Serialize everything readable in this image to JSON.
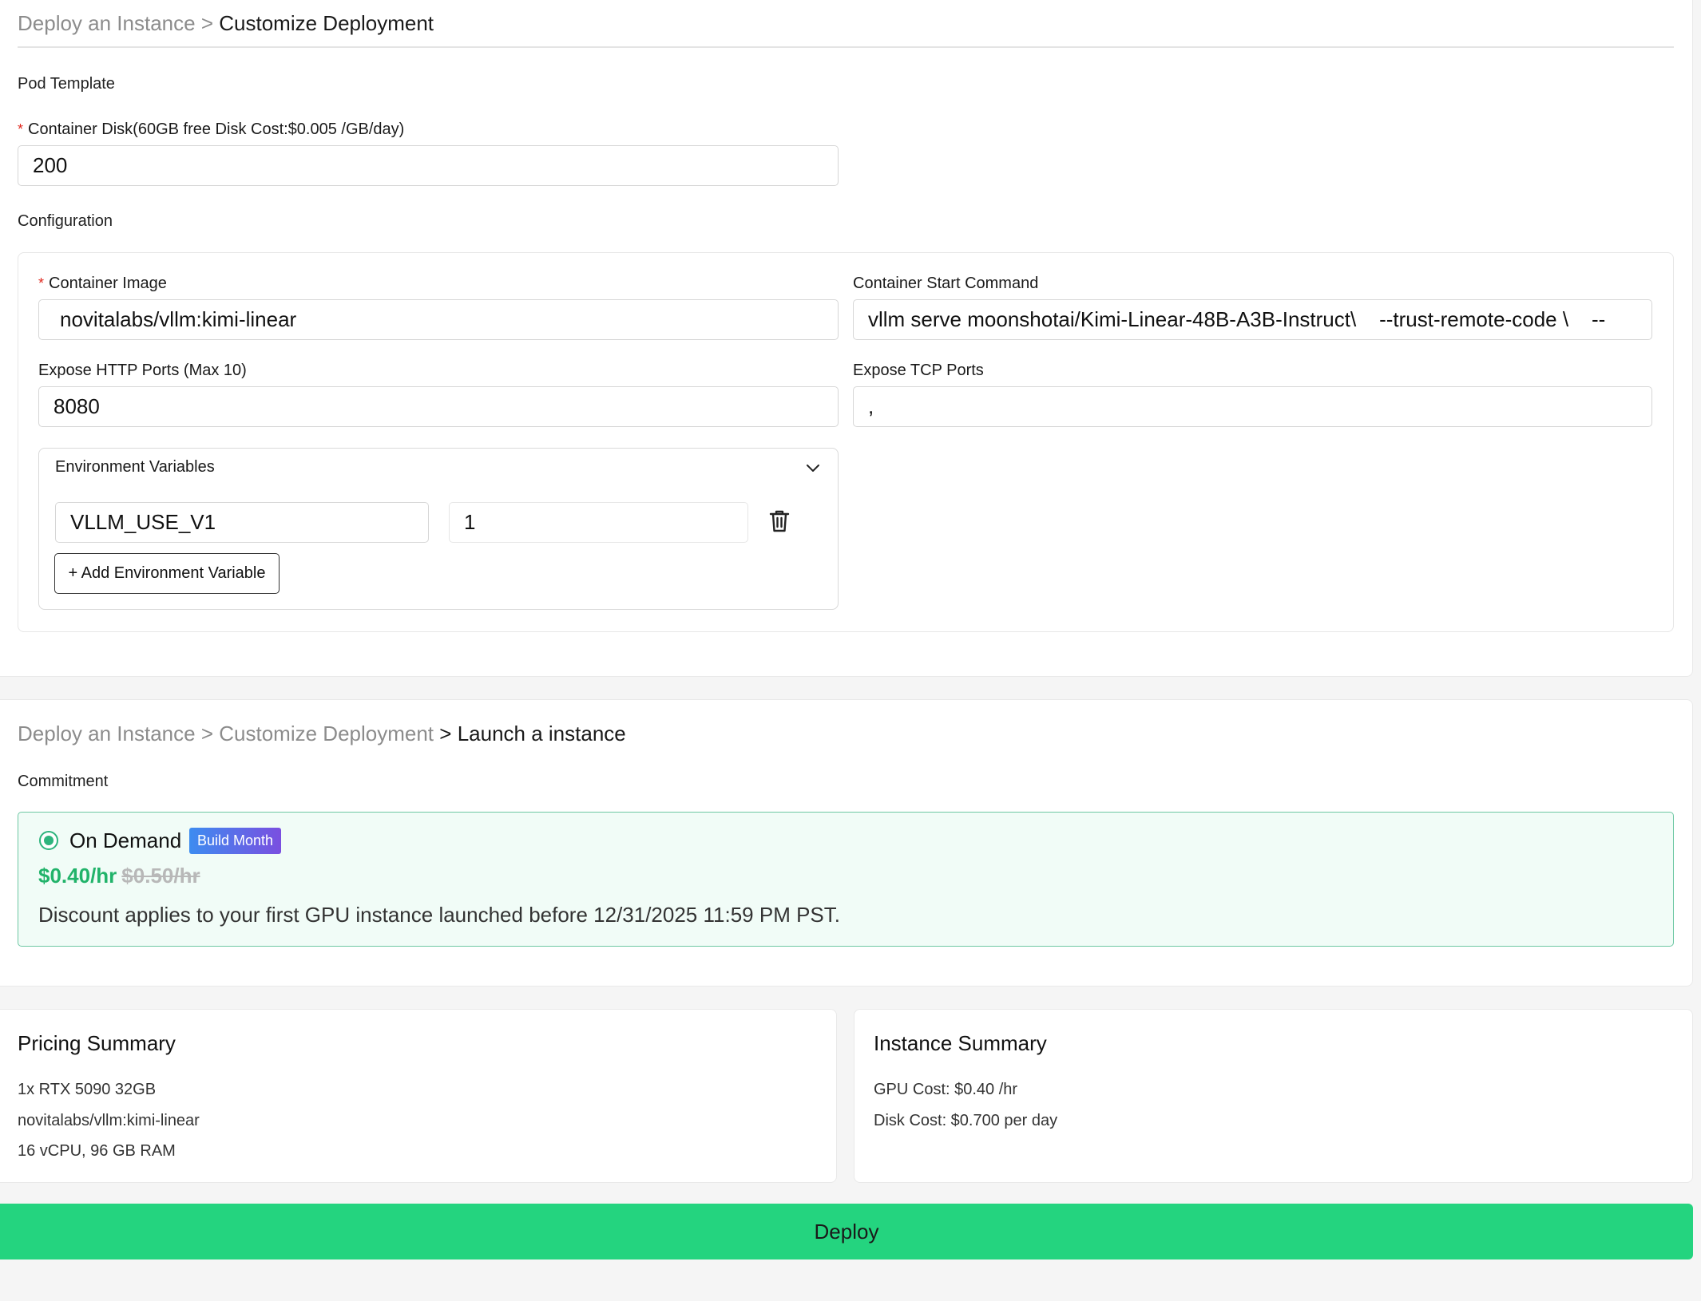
{
  "customize": {
    "breadcrumb": {
      "step1": "Deploy an Instance",
      "sep": ">",
      "step2": "Customize Deployment"
    },
    "pod_template_label": "Pod Template",
    "container_disk": {
      "label": "Container Disk(60GB free Disk Cost:$0.005 /GB/day)",
      "value": "200"
    },
    "configuration_label": "Configuration",
    "container_image": {
      "label": "Container Image",
      "value": "novitalabs/vllm:kimi-linear"
    },
    "start_command": {
      "label": "Container Start Command",
      "value": "vllm serve moonshotai/Kimi-Linear-48B-A3B-Instruct\\    --trust-remote-code \\    --"
    },
    "http_ports": {
      "label": "Expose HTTP Ports (Max 10)",
      "value": "8080"
    },
    "tcp_ports": {
      "label": "Expose TCP Ports",
      "value": ","
    },
    "env": {
      "title": "Environment Variables",
      "vars": [
        {
          "key": "VLLM_USE_V1",
          "value": "1"
        }
      ],
      "add_label": "+ Add Environment Variable"
    }
  },
  "launch": {
    "breadcrumb": {
      "step1": "Deploy an Instance",
      "sep1": ">",
      "step2": "Customize Deployment",
      "sep2": ">",
      "step3": "Launch a instance"
    },
    "commitment_label": "Commitment",
    "option": {
      "title": "On Demand",
      "badge": "Build Month",
      "price": "$0.40/hr",
      "old_price": "$0.50/hr",
      "note": "Discount applies to your first GPU instance launched before 12/31/2025 11:59 PM PST."
    }
  },
  "pricing_summary": {
    "title": "Pricing Summary",
    "lines": [
      "1x RTX 5090 32GB",
      "novitalabs/vllm:kimi-linear",
      "16 vCPU, 96 GB RAM"
    ]
  },
  "instance_summary": {
    "title": "Instance Summary",
    "lines": [
      "GPU Cost: $0.40 /hr",
      "Disk Cost: $0.700 per day"
    ]
  },
  "deploy_label": "Deploy",
  "colors": {
    "accent_green": "#24d47f",
    "price_green": "#21b36a",
    "badge_start": "#3d8cf0",
    "badge_end": "#7a4fe0",
    "required": "#e0281e"
  }
}
